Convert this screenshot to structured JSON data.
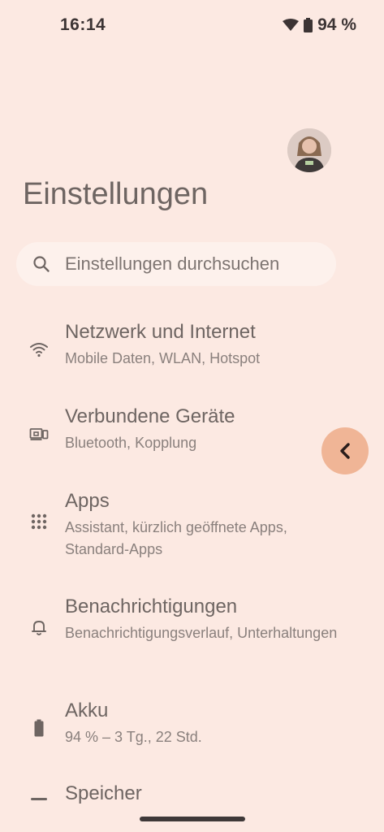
{
  "status_bar": {
    "time": "16:14",
    "battery_percent": "94 %"
  },
  "header": {
    "title": "Einstellungen",
    "avatar_icon": "profile-avatar"
  },
  "search": {
    "placeholder": "Einstellungen durchsuchen",
    "value": ""
  },
  "settings": [
    {
      "title": "Netzwerk und Internet",
      "subtitle": "Mobile Daten, WLAN, Hotspot",
      "icon": "wifi-icon"
    },
    {
      "title": "Verbundene Geräte",
      "subtitle": "Bluetooth, Kopplung",
      "icon": "devices-icon"
    },
    {
      "title": "Apps",
      "subtitle": "Assistant, kürzlich geöffnete Apps, Standard-Apps",
      "icon": "apps-grid-icon"
    },
    {
      "title": "Benachrichtigungen",
      "subtitle": "Benachrichtigungsverlauf, Unterhaltungen",
      "icon": "bell-icon"
    },
    {
      "title": "Akku",
      "subtitle": "94 % – 3 Tg., 22 Std.",
      "icon": "battery-icon"
    },
    {
      "title": "Speicher",
      "subtitle": "",
      "icon": "storage-icon"
    }
  ],
  "colors": {
    "background": "#fce9e2",
    "back_bubble": "#f0b596",
    "text_primary": "#6e6562",
    "text_secondary": "#8a807d"
  }
}
